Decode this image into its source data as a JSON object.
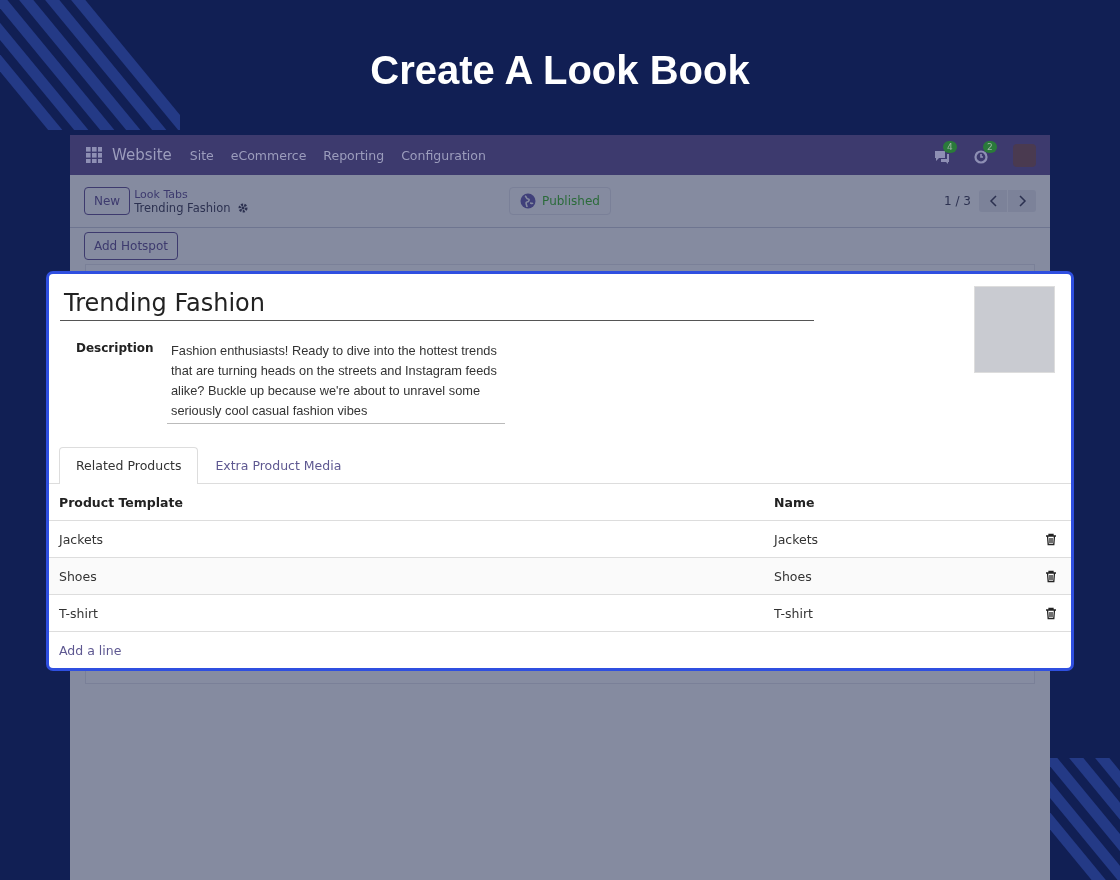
{
  "page_title": "Create A Look Book",
  "navbar": {
    "app": "Website",
    "menu": [
      "Site",
      "eCommerce",
      "Reporting",
      "Configuration"
    ],
    "messages_badge": "4",
    "activities_badge": "2"
  },
  "control_panel": {
    "new_button": "New",
    "breadcrumb_parent": "Look Tabs",
    "breadcrumb_current": "Trending Fashion",
    "status": "Published",
    "pager": "1 / 3"
  },
  "action_button": "Add Hotspot",
  "form": {
    "title": "Trending Fashion",
    "description_label": "Description",
    "description": "Fashion enthusiasts!  Ready to dive into the hottest trends that are turning heads on the streets and Instagram feeds alike? Buckle up because we're about to unravel some seriously cool casual fashion vibes",
    "tabs": [
      {
        "label": "Related Products",
        "selected": true
      },
      {
        "label": "Extra Product Media",
        "selected": false
      }
    ],
    "columns": [
      "Product Template",
      "Name"
    ],
    "rows": [
      {
        "product_template": "Jackets",
        "name": "Jackets"
      },
      {
        "product_template": "Shoes",
        "name": "Shoes"
      },
      {
        "product_template": "T-shirt",
        "name": "T-shirt"
      }
    ],
    "add_line": "Add a line"
  }
}
